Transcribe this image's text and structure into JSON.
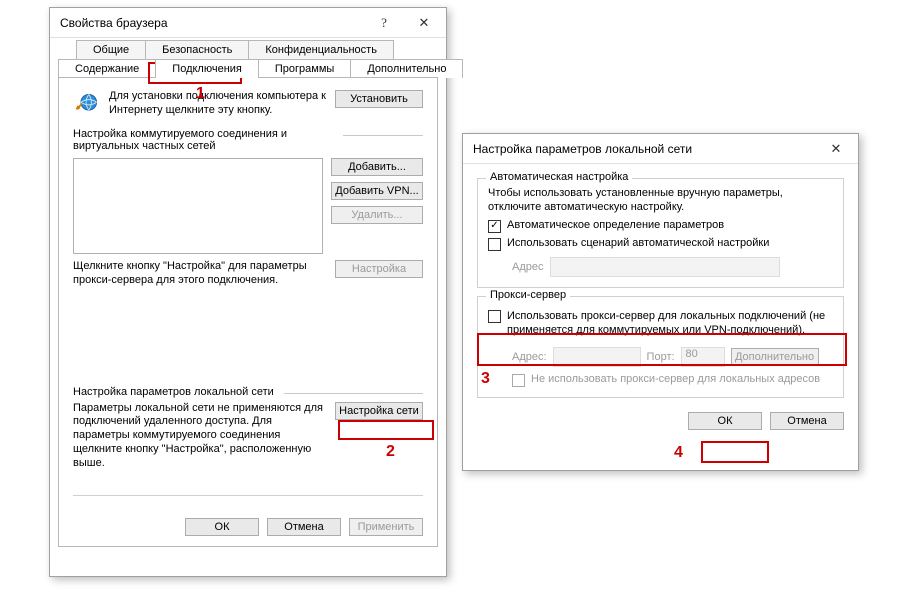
{
  "dlg1": {
    "title": "Свойства браузера",
    "help_glyph": "?",
    "close_glyph": "✕",
    "tabs": {
      "row1": [
        "Общие",
        "Безопасность",
        "Конфиденциальность"
      ],
      "row2": [
        "Содержание",
        "Подключения",
        "Программы",
        "Дополнительно"
      ]
    },
    "install_text": "Для установки подключения компьютера к Интернету щелкните эту кнопку.",
    "install_btn": "Установить",
    "dialup_header": "Настройка коммутируемого соединения и виртуальных частных сетей",
    "add_btn": "Добавить...",
    "add_vpn_btn": "Добавить VPN...",
    "delete_btn": "Удалить...",
    "settings_btn": "Настройка",
    "dialup_note": "Щелкните кнопку \"Настройка\" для параметры прокси-сервера для этого подключения.",
    "lan_header": "Настройка параметров локальной сети",
    "lan_note": "Параметры локальной сети не применяются для подключений удаленного доступа. Для параметры коммутируемого соединения щелкните кнопку \"Настройка\", расположенную выше.",
    "lan_btn": "Настройка сети",
    "ok": "ОК",
    "cancel": "Отмена",
    "apply": "Применить"
  },
  "dlg2": {
    "title": "Настройка параметров локальной сети",
    "close_glyph": "✕",
    "auto_legend": "Автоматическая настройка",
    "auto_note": "Чтобы использовать установленные вручную параметры, отключите автоматическую настройку.",
    "auto_detect": "Автоматическое определение параметров",
    "use_script": "Использовать сценарий автоматической настройки",
    "addr_label": "Адрес",
    "proxy_legend": "Прокси-сервер",
    "use_proxy": "Использовать прокси-сервер для локальных подключений (не применяется для коммутируемых или VPN-подключений).",
    "addr2_label": "Адрес:",
    "port_label": "Порт:",
    "port_value": "80",
    "advanced_btn": "Дополнительно",
    "bypass_local": "Не использовать прокси-сервер для локальных адресов",
    "ok": "ОК",
    "cancel": "Отмена"
  },
  "annot": {
    "n1": "1",
    "n2": "2",
    "n3": "3",
    "n4": "4"
  }
}
